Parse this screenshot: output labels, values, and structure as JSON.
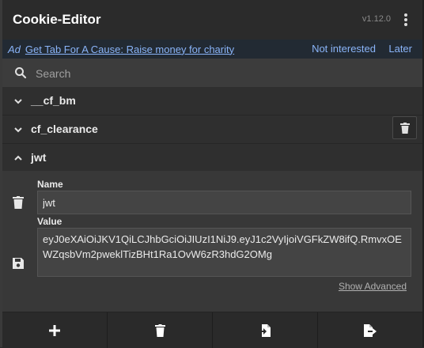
{
  "header": {
    "title": "Cookie-Editor",
    "version": "v1.12.0"
  },
  "ad": {
    "tag": "Ad",
    "link_text": "Get Tab For A Cause: Raise money for charity",
    "not_interested": "Not interested",
    "later": "Later"
  },
  "search": {
    "placeholder": "Search"
  },
  "cookies": [
    {
      "name": "__cf_bm",
      "expanded": false
    },
    {
      "name": "cf_clearance",
      "expanded": false
    },
    {
      "name": "jwt",
      "expanded": true
    }
  ],
  "editor": {
    "name_label": "Name",
    "name_value": "jwt",
    "value_label": "Value",
    "value_value": "eyJ0eXAiOiJKV1QiLCJhbGciOiJIUzI1NiJ9.eyJ1c2VyIjoiVGFkZW8ifQ.RmvxOEWZqsbVm2pweklTizBHt1Ra1OvW6zR3hdG2OMg",
    "show_advanced": "Show Advanced"
  },
  "colors": {
    "accent": "#8ab4f8",
    "background": "#2f2f2f",
    "panel": "#383838"
  },
  "toolbar_icons": [
    "plus-icon",
    "trash-icon",
    "import-icon",
    "export-icon"
  ]
}
